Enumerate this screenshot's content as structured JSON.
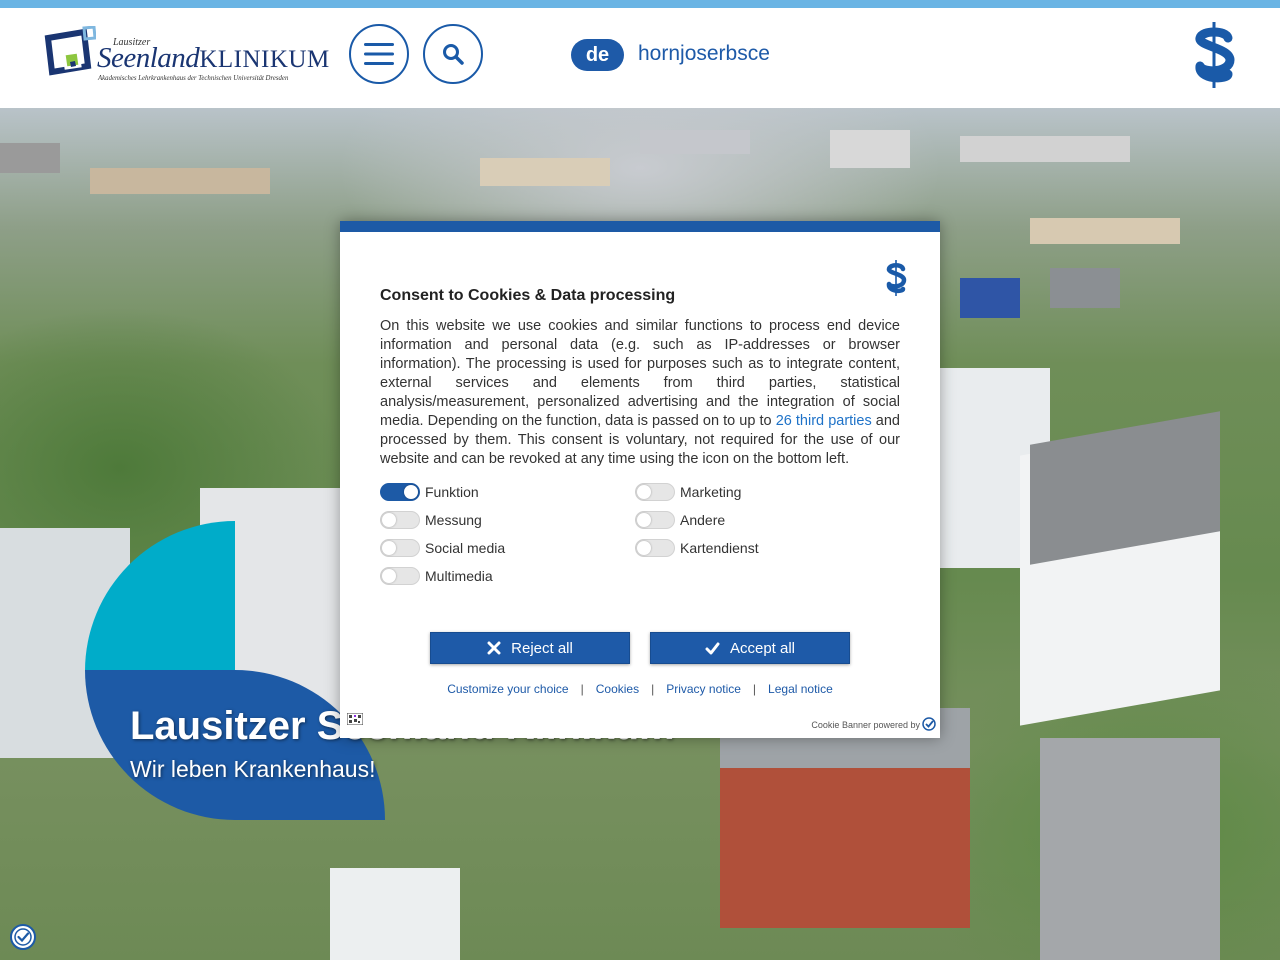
{
  "colors": {
    "brand_blue": "#1d5aa6",
    "link_blue": "#1e72c8",
    "teal": "#00acc9",
    "top_strip": "#6ab4e4"
  },
  "header": {
    "logo": {
      "small": "Lausitzer",
      "main_seenland": "Seenland",
      "main_klinikum": "KLINIKUM",
      "sub": "Akademisches Lehrkrankenhaus der Technischen Universität Dresden"
    },
    "menu_icon": "hamburger-icon",
    "search_icon": "search-icon",
    "language_active": "de",
    "language_other": "hornjoserbsce",
    "brand_icon": "sana-s-logo-icon"
  },
  "hero": {
    "title": "Lausitzer Seenland Klinikum",
    "subtitle": "Wir leben Krankenhaus!"
  },
  "consent": {
    "title": "Consent to Cookies & Data processing",
    "text_before_link": "On this website we use cookies and similar functions to process end device information and personal data (e.g. such as IP-addresses or browser information). The processing is used for purposes such as to integrate content, external services and elements from third parties, statistical analysis/measurement, personalized advertising and the integration of social media. Depending on the function, data is passed on to up to ",
    "link_text": "26 third parties",
    "text_after_link": " and processed by them. This consent is voluntary, not required for the use of our website and can be revoked at any time using the icon on the bottom left.",
    "toggles": [
      {
        "label": "Funktion",
        "checked": true
      },
      {
        "label": "Marketing",
        "checked": false
      },
      {
        "label": "Messung",
        "checked": false
      },
      {
        "label": "Andere",
        "checked": false
      },
      {
        "label": "Social media",
        "checked": false
      },
      {
        "label": "Kartendienst",
        "checked": false
      },
      {
        "label": "Multimedia",
        "checked": false
      }
    ],
    "reject_label": "Reject all",
    "accept_label": "Accept all",
    "links": [
      "Customize your choice",
      "Cookies",
      "Privacy notice",
      "Legal notice"
    ],
    "powered_by": "Cookie Banner powered by"
  }
}
